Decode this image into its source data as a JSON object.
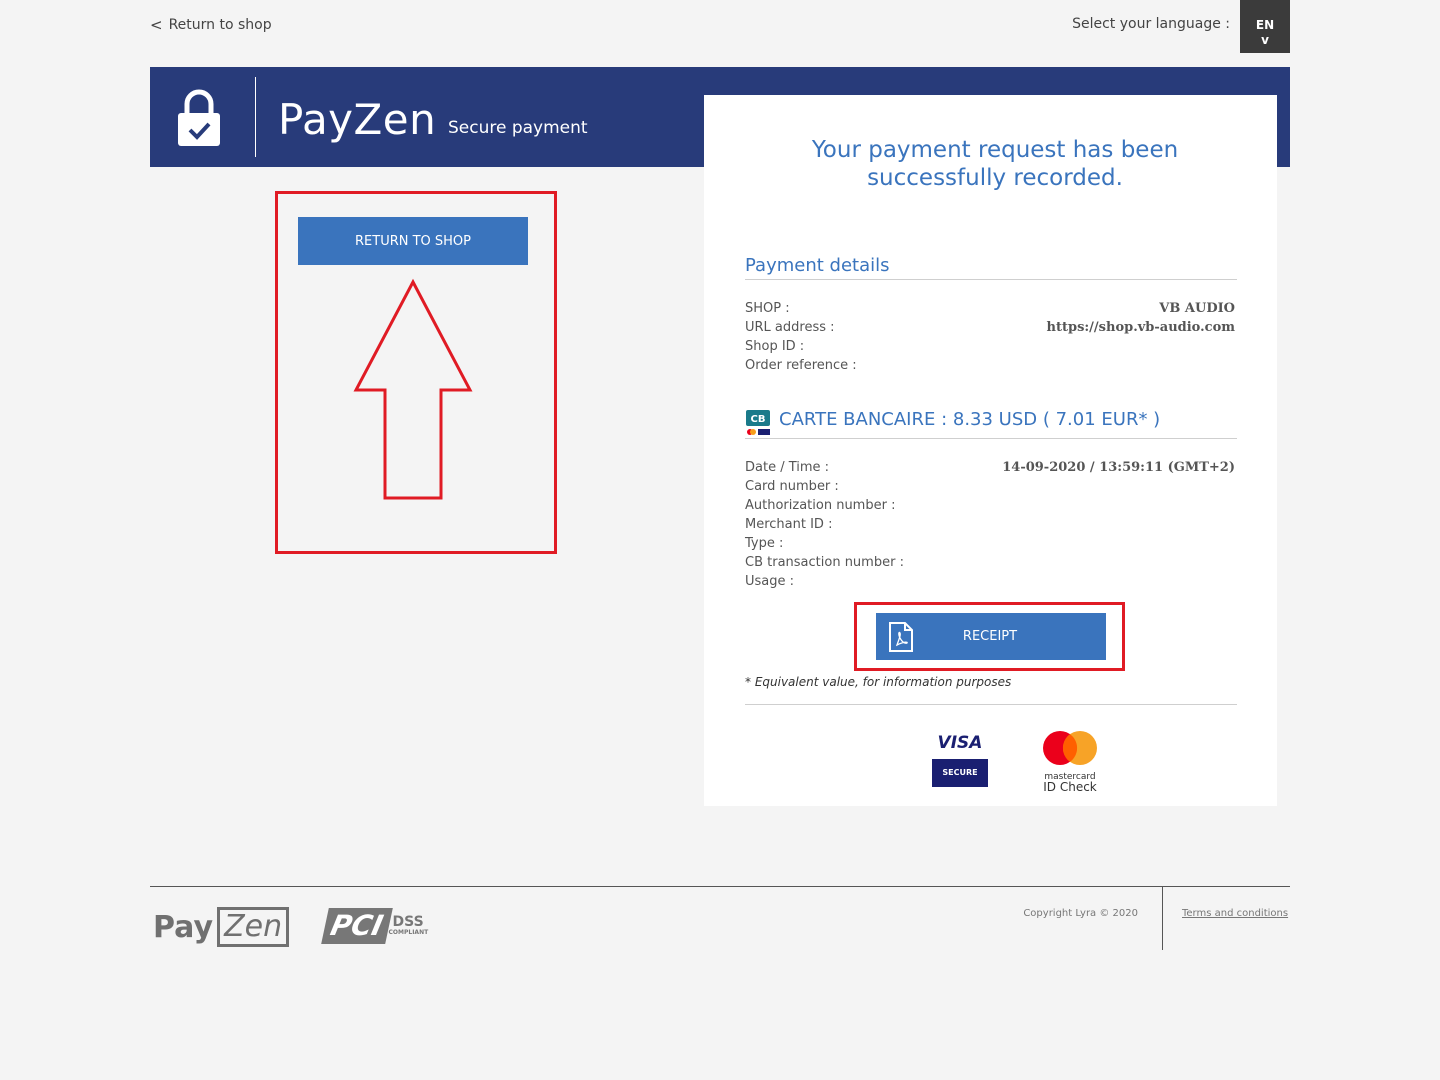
{
  "topbar": {
    "back_chevron": "<",
    "back_label": "Return to shop",
    "language_label": "Select your language :",
    "language_code": "EN",
    "language_chevron": "v"
  },
  "header": {
    "brand": "PayZen",
    "subtitle": "Secure payment",
    "lock_icon": "lock-check-icon",
    "band_color": "#283b7a"
  },
  "left": {
    "return_button_label": "RETURN TO SHOP",
    "annotation_color": "#e01b24"
  },
  "card": {
    "success_line1": "Your payment request has been",
    "success_line2": "successfully recorded.",
    "details_title": "Payment details",
    "details": [
      {
        "label": "SHOP :",
        "value": "VB AUDIO"
      },
      {
        "label": "URL address :",
        "value": "https://shop.vb-audio.com"
      },
      {
        "label": "Shop ID :",
        "value": ""
      },
      {
        "label": "Order reference :",
        "value": ""
      }
    ],
    "card_icon": "cb-card-icon",
    "card_title": "CARTE BANCAIRE : 8.33 USD ( 7.01 EUR* )",
    "transaction": [
      {
        "label": "Date / Time :",
        "value": "14-09-2020 / 13:59:11 (GMT+2)"
      },
      {
        "label": "Card number :",
        "value": ""
      },
      {
        "label": "Authorization number :",
        "value": ""
      },
      {
        "label": "Merchant ID :",
        "value": ""
      },
      {
        "label": "Type :",
        "value": ""
      },
      {
        "label": "CB transaction number :",
        "value": ""
      },
      {
        "label": "Usage :",
        "value": ""
      }
    ],
    "receipt_label": "RECEIPT",
    "receipt_icon": "pdf-file-icon",
    "footnote": "* Equivalent value, for information purposes",
    "visa_word": "VISA",
    "visa_secure": "SECURE",
    "mc_word": "mastercard",
    "mc_check": "ID Check",
    "accent_color": "#3a74bd"
  },
  "footer": {
    "payzen_pay": "Pay",
    "payzen_zen": "Zen",
    "pci_mark": "PCI",
    "pci_dss": "DSS",
    "pci_compliant": "COMPLIANT",
    "copyright": "Copyright Lyra © 2020",
    "terms": "Terms and conditions"
  }
}
